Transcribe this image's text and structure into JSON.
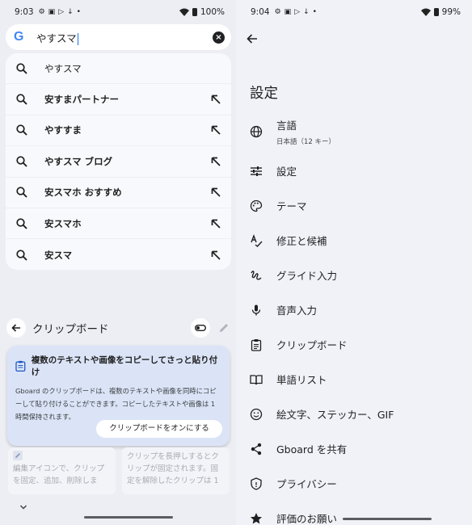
{
  "left": {
    "status": {
      "time": "9:03",
      "battery": "100%"
    },
    "search": {
      "query": "やすスマ"
    },
    "suggestions": [
      {
        "text": "やすスマ",
        "bold": false,
        "has_arrow": false
      },
      {
        "text": "安すまパートナー",
        "bold": true,
        "has_arrow": true
      },
      {
        "text": "やすすま",
        "bold": true,
        "has_arrow": true
      },
      {
        "text": "やすスマ ブログ",
        "bold": true,
        "has_arrow": true
      },
      {
        "text": "安スマホ おすすめ",
        "bold": true,
        "has_arrow": true
      },
      {
        "text": "安スマホ",
        "bold": true,
        "has_arrow": true
      },
      {
        "text": "安スマ",
        "bold": true,
        "has_arrow": true
      }
    ],
    "clipboard": {
      "title": "クリップボード",
      "card_title": "複数のテキストや画像をコピーしてさっと貼り付け",
      "card_body": "Gboard のクリップボードは、複数のテキストや画像を同時にコピーして貼り付けることができます。コピーしたテキストや画像は 1 時間保持されます。",
      "card_button": "クリップボードをオンにする",
      "tile_left": "編集アイコンで、クリップを固定、追加、削除しま",
      "tile_right": "クリップを長押しするとクリップが固定されます。固定を解除したクリップは 1"
    }
  },
  "right": {
    "status": {
      "time": "9:04",
      "battery": "99%"
    },
    "title": "設定",
    "items": [
      {
        "icon": "globe-icon",
        "label": "言語",
        "sub": "日本語（12 キー）"
      },
      {
        "icon": "sliders-icon",
        "label": "設定",
        "sub": ""
      },
      {
        "icon": "palette-icon",
        "label": "テーマ",
        "sub": ""
      },
      {
        "icon": "spellcheck-icon",
        "label": "修正と候補",
        "sub": ""
      },
      {
        "icon": "gesture-icon",
        "label": "グライド入力",
        "sub": ""
      },
      {
        "icon": "mic-icon",
        "label": "音声入力",
        "sub": ""
      },
      {
        "icon": "clipboard-icon",
        "label": "クリップボード",
        "sub": ""
      },
      {
        "icon": "dictionary-icon",
        "label": "単語リスト",
        "sub": ""
      },
      {
        "icon": "emoji-icon",
        "label": "絵文字、ステッカー、GIF",
        "sub": ""
      },
      {
        "icon": "share-icon",
        "label": "Gboard を共有",
        "sub": ""
      },
      {
        "icon": "shield-icon",
        "label": "プライバシー",
        "sub": ""
      },
      {
        "icon": "star-icon",
        "label": "評価のお願い",
        "sub": ""
      }
    ]
  },
  "colors": {
    "accent": "#1a73e8",
    "google_blue": "#4285f4"
  }
}
